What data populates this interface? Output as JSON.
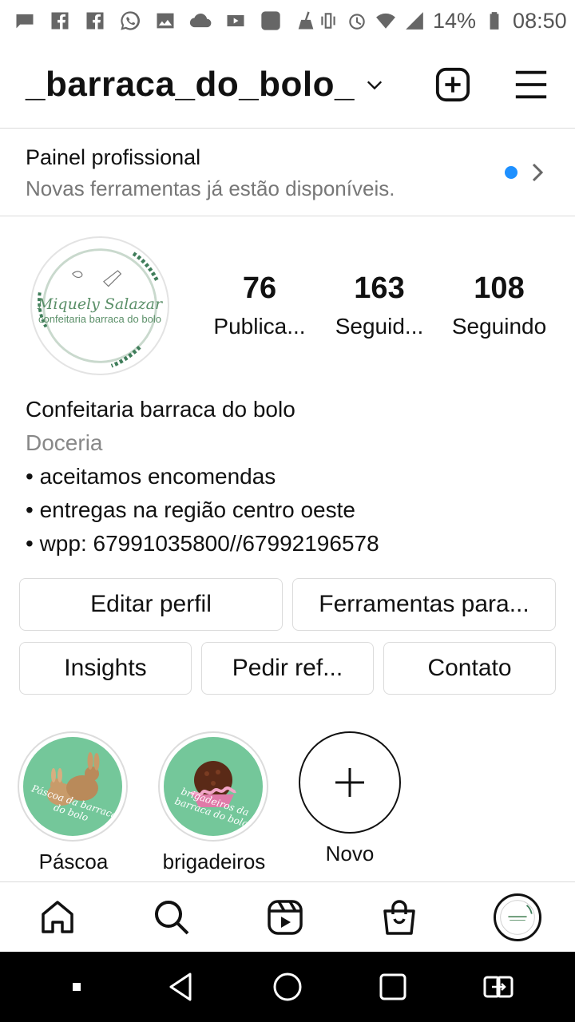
{
  "status_bar": {
    "icons": [
      "chat-icon",
      "facebook-icon",
      "facebook-icon",
      "whatsapp-icon",
      "image-icon",
      "cloud-icon",
      "youtube-icon",
      "app-icon",
      "cleaner-icon",
      "vibrate-icon",
      "alarm-icon",
      "wifi-icon",
      "signal-icon",
      "battery-icon"
    ],
    "battery": "14%",
    "time": "08:50"
  },
  "header": {
    "username": "_barraca_do_bolo_"
  },
  "painel": {
    "title": "Painel profissional",
    "subtitle": "Novas ferramentas já estão disponíveis."
  },
  "profile": {
    "avatar_name": "Miquely Salazar",
    "avatar_sub": "confeitaria barraca do bolo",
    "stats": [
      {
        "value": "76",
        "label": "Publica..."
      },
      {
        "value": "163",
        "label": "Seguid..."
      },
      {
        "value": "108",
        "label": "Seguindo"
      }
    ],
    "bio": {
      "name": "Confeitaria barraca do bolo",
      "category": "Doceria",
      "lines": [
        "• aceitamos encomendas",
        "• entregas na região centro oeste",
        "• wpp: 67991035800//67992196578"
      ]
    }
  },
  "buttons": {
    "edit_profile": "Editar perfil",
    "tools": "Ferramentas para...",
    "insights": "Insights",
    "request": "Pedir ref...",
    "contact": "Contato"
  },
  "highlights": [
    {
      "label": "Páscoa",
      "caption": "Páscoa da barraca do bolo"
    },
    {
      "label": "brigadeiros",
      "caption": "brigadeiros da barraca do bolo"
    },
    {
      "label": "Novo"
    }
  ],
  "colors": {
    "accent_dot": "#1e90ff",
    "highlight_bg": "#74c79a",
    "logo_green": "#5a8f68"
  }
}
